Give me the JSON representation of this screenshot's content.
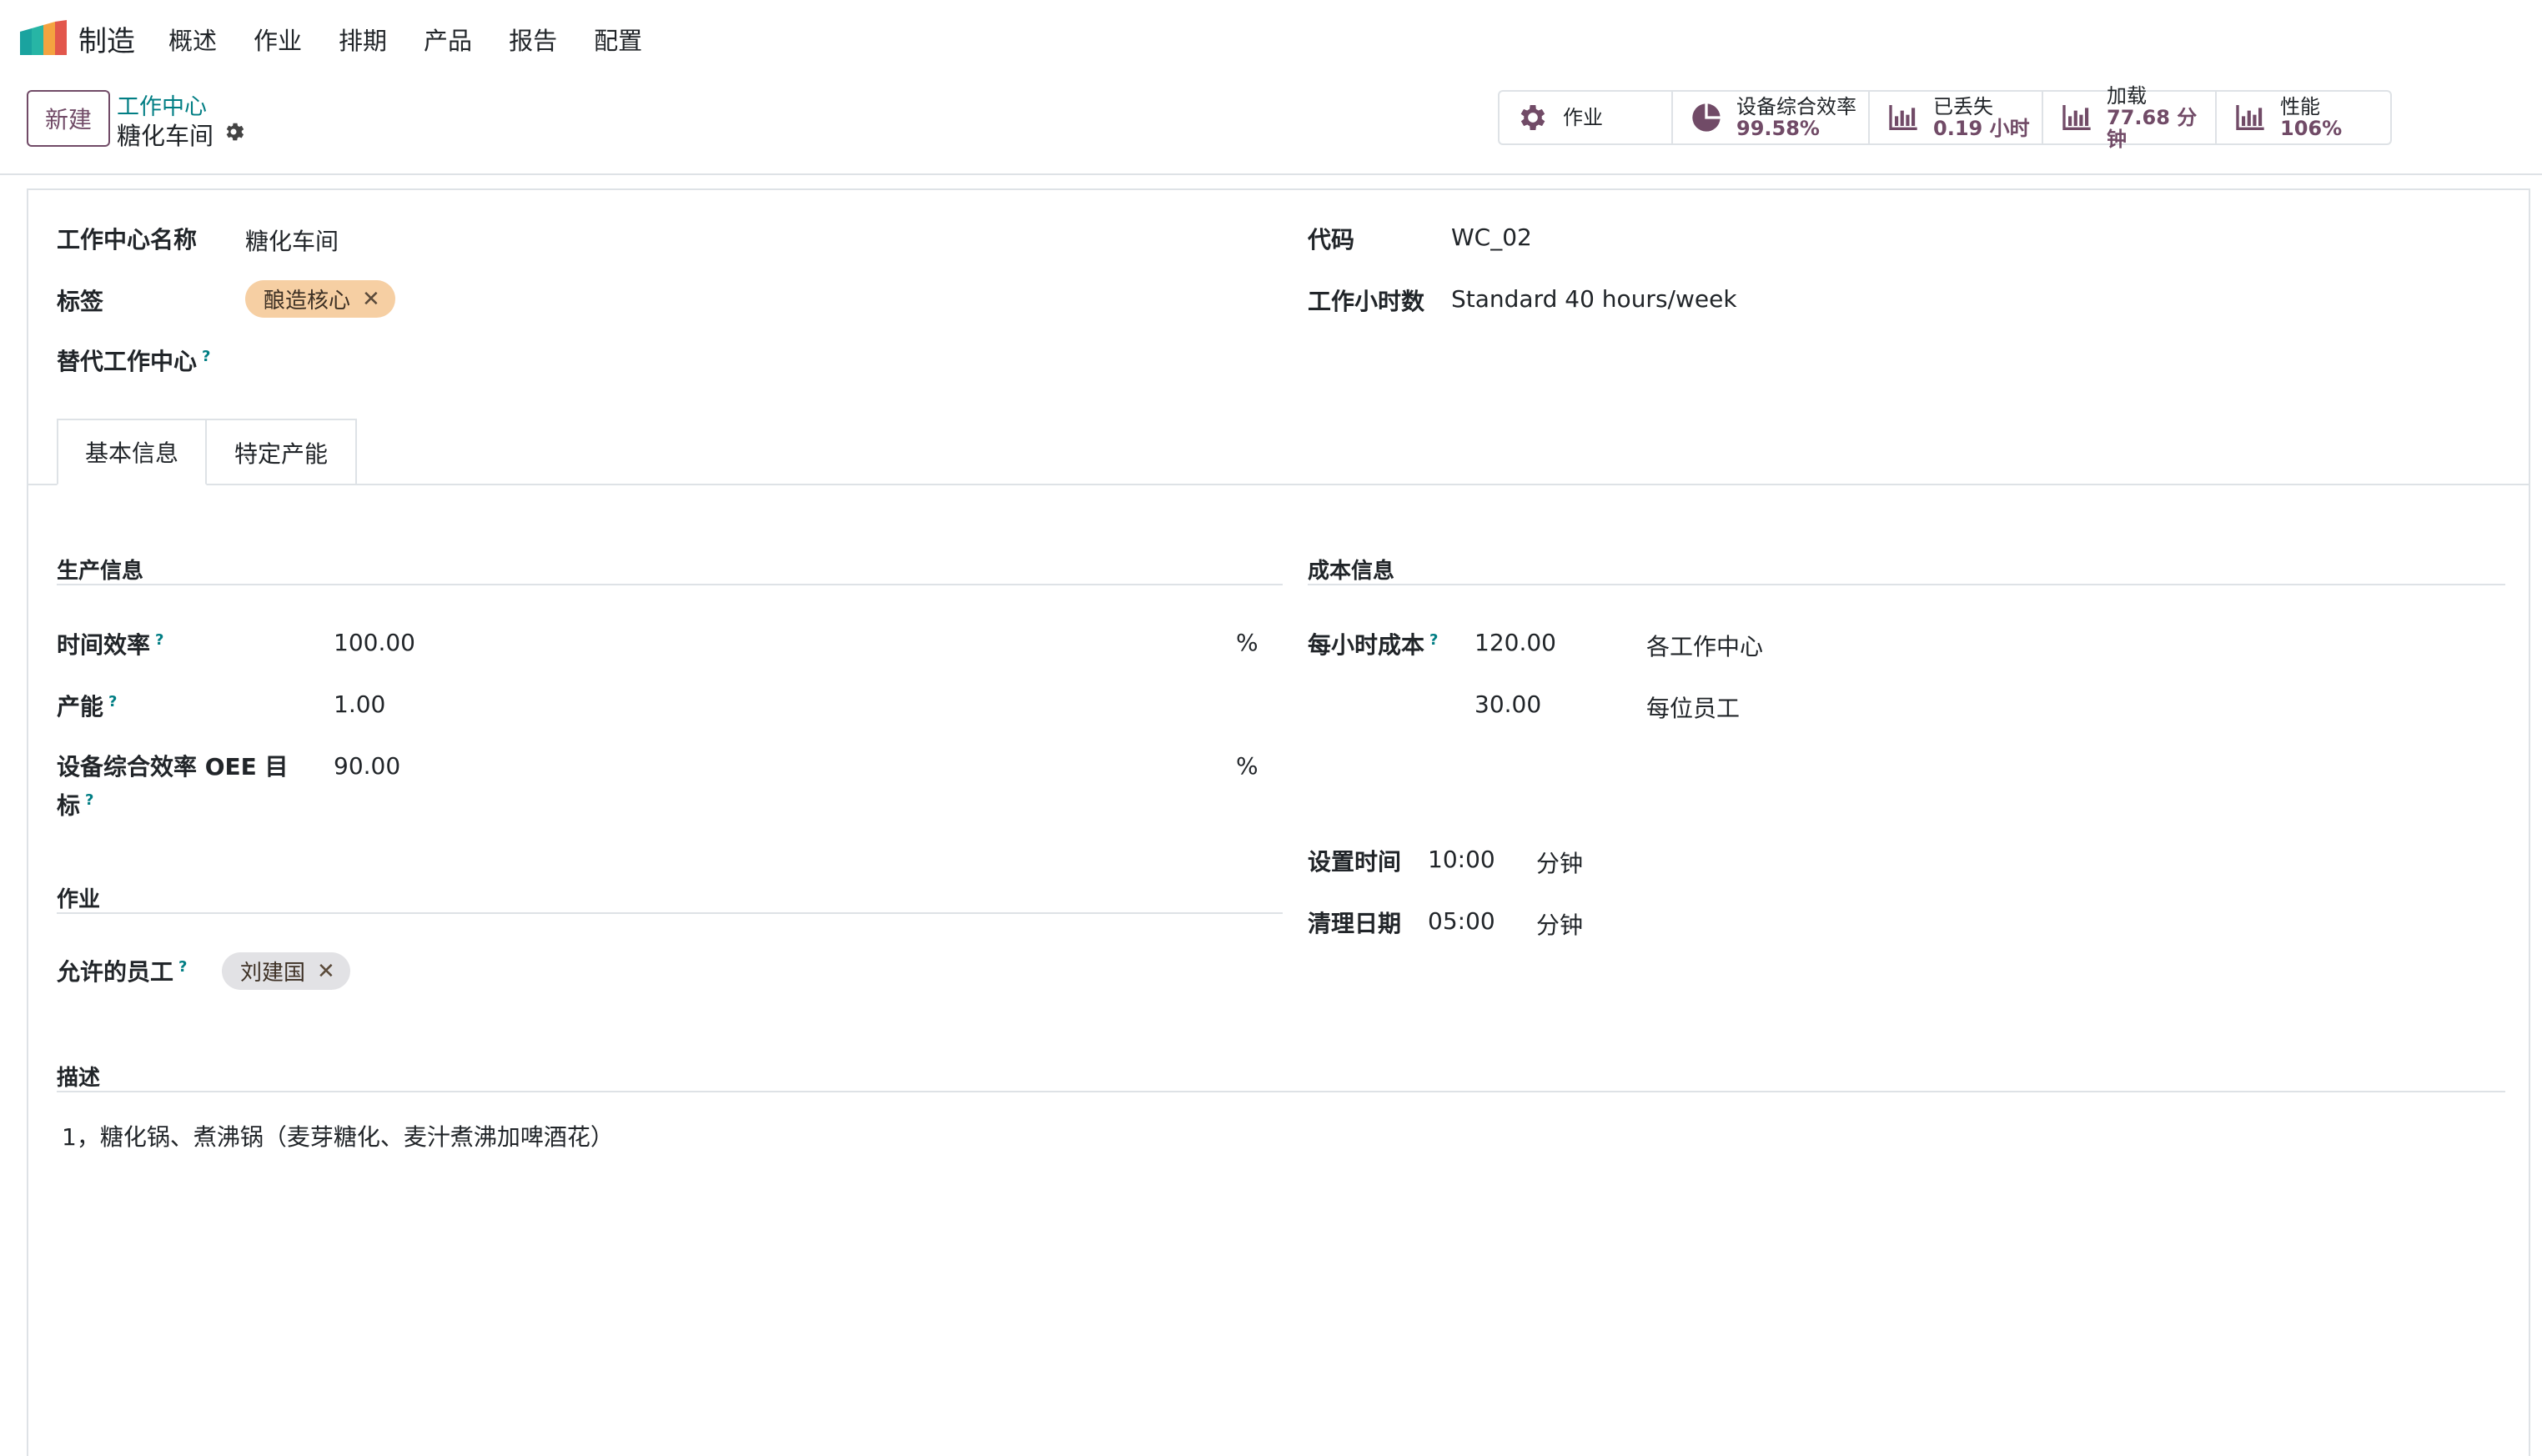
{
  "nav": {
    "app_name": "制造",
    "menu": [
      "概述",
      "作业",
      "排期",
      "产品",
      "报告",
      "配置"
    ]
  },
  "control": {
    "new_button": "新建",
    "breadcrumb_parent": "工作中心",
    "breadcrumb_current": "糖化车间"
  },
  "stats": [
    {
      "label": "作业",
      "value": "",
      "icon": "gear-icon"
    },
    {
      "label": "设备综合效率",
      "value": "99.58%",
      "icon": "pie-chart-icon"
    },
    {
      "label": "已丢失",
      "value": "0.19 小时",
      "icon": "bar-chart-icon"
    },
    {
      "label": "加载",
      "value": "77.68 分钟",
      "icon": "bar-chart-icon"
    },
    {
      "label": "性能",
      "value": "106%",
      "icon": "bar-chart-icon"
    }
  ],
  "form": {
    "name_label": "工作中心名称",
    "name_value": "糖化车间",
    "tags_label": "标签",
    "tag_value": "酿造核心",
    "alt_label": "替代工作中心",
    "code_label": "代码",
    "code_value": "WC_02",
    "hours_label": "工作小时数",
    "hours_value": "Standard 40 hours/week",
    "help_mark": "?",
    "remove_mark": "✕"
  },
  "tabs": [
    "基本信息",
    "特定产能"
  ],
  "production": {
    "title": "生产信息",
    "time_eff_label": "时间效率",
    "time_eff_value": "100.00",
    "capacity_label": "产能",
    "capacity_value": "1.00",
    "oee_label_line1": "设备综合效率 OEE 目",
    "oee_label_line2": "标",
    "oee_value": "90.00",
    "percent": "%"
  },
  "cost": {
    "title": "成本信息",
    "hourly_label": "每小时成本",
    "hourly_value": "120.00",
    "hourly_unit": "各工作中心",
    "employee_value": "30.00",
    "employee_unit": "每位员工",
    "setup_label": "设置时间",
    "setup_value": "10:00",
    "setup_unit": "分钟",
    "cleanup_label": "清理日期",
    "cleanup_value": "05:00",
    "cleanup_unit": "分钟"
  },
  "operations": {
    "title": "作业",
    "employees_label": "允许的员工",
    "employee_tag": "刘建国"
  },
  "description": {
    "title": "描述",
    "text": "1，糖化锅、煮沸锅（麦芽糖化、麦汁煮沸加啤酒花）"
  },
  "colors": {
    "primary": "#714b67",
    "link": "#017e84",
    "tag_orange": "#f6cfa3",
    "tag_grey": "#e2e2e5"
  }
}
